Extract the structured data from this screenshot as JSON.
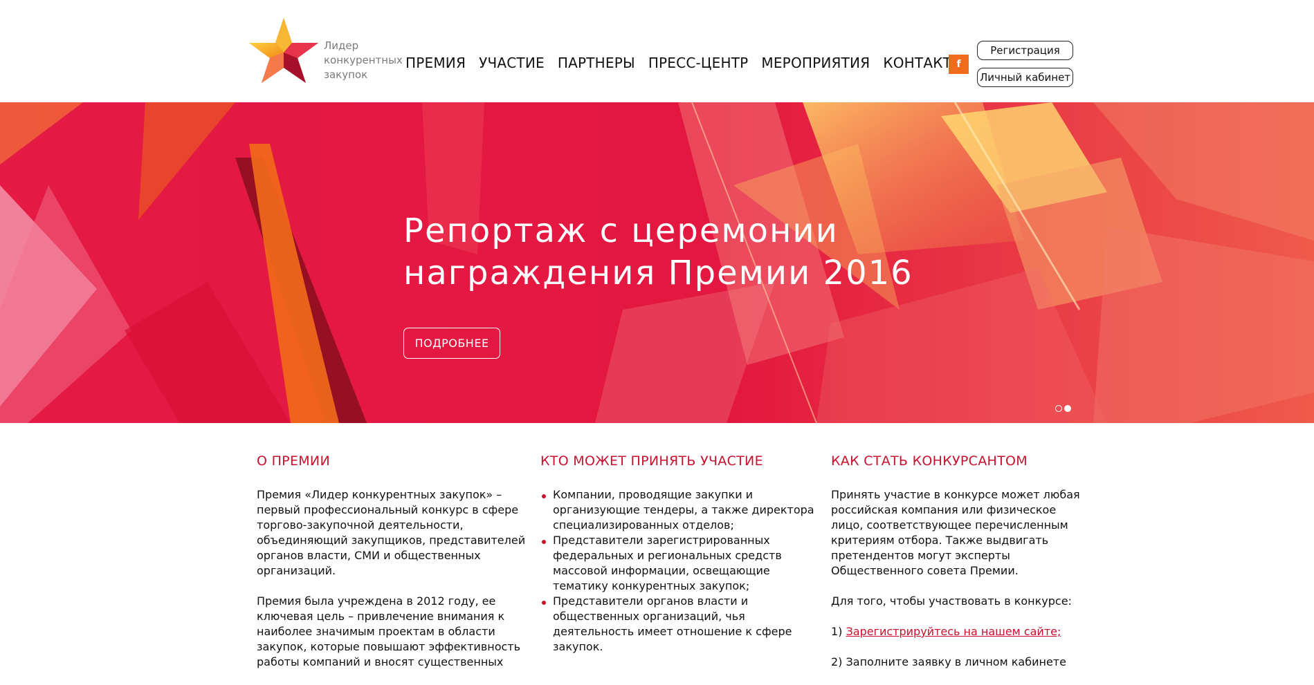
{
  "logo": {
    "lines": [
      "Лидер",
      "конкурентных",
      "закупок"
    ]
  },
  "nav": {
    "items": [
      "ПРЕМИЯ",
      "УЧАСТИЕ",
      "ПАРТНЕРЫ",
      "ПРЕСС-ЦЕНТР",
      "МЕРОПРИЯТИЯ",
      "КОНТАКТЫ"
    ]
  },
  "social": {
    "facebook_label": "f"
  },
  "auth": {
    "register_label": "Регистрация",
    "cabinet_label": "Личный кабинет"
  },
  "hero": {
    "title_lines": [
      "Репортаж с церемонии",
      "награждения Премии 2016"
    ],
    "button_label": "ПОДРОБНЕЕ",
    "slides_count": 2,
    "active_slide": 2
  },
  "about": {
    "title": "О ПРЕМИИ",
    "paragraphs": [
      "Премия «Лидер конкурентных закупок» – первый профессиональный конкурс в сфере торгово-закупочной деятельности, объединяющий закупщиков, представителей органов власти, СМИ и общественных организаций.",
      "Премия была учреждена в 2012 году, ее ключевая цель – привлечение внимания к наиболее значимым проектам в области закупок, которые повышают эффективность работы компаний и вносят существенных"
    ]
  },
  "who": {
    "title": "КТО МОЖЕТ ПРИНЯТЬ УЧАСТИЕ",
    "items": [
      "Компании, проводящие закупки и организующие тендеры, а также директора специализированных отделов;",
      "Представители зарегистрированных федеральных и региональных средств массовой информации, освещающие тематику конкурентных закупок;",
      "Представители органов власти и общественных организаций, чья деятельность имеет отношение к сфере закупок."
    ]
  },
  "how": {
    "title": "КАК СТАТЬ КОНКУРСАНТОМ",
    "paragraph1": "Принять участие в конкурсе может любая российская компания или физическое лицо, соответствующее перечисленным критериям отбора. Также выдвигать претендентов могут эксперты Общественного совета Премии.",
    "paragraph2": "Для того, чтобы участвовать в конкурсе:",
    "step1_prefix": "1) ",
    "step1_link": "Зарегистрируйтесь на нашем сайте;",
    "step2": "2) Заполните заявку в личном кабинете"
  },
  "colors": {
    "accent": "#c8102e",
    "hero_red": "#e3173f",
    "facebook_orange": "#f26b1d"
  },
  "icons": [
    "logo-star-icon",
    "facebook-icon"
  ]
}
